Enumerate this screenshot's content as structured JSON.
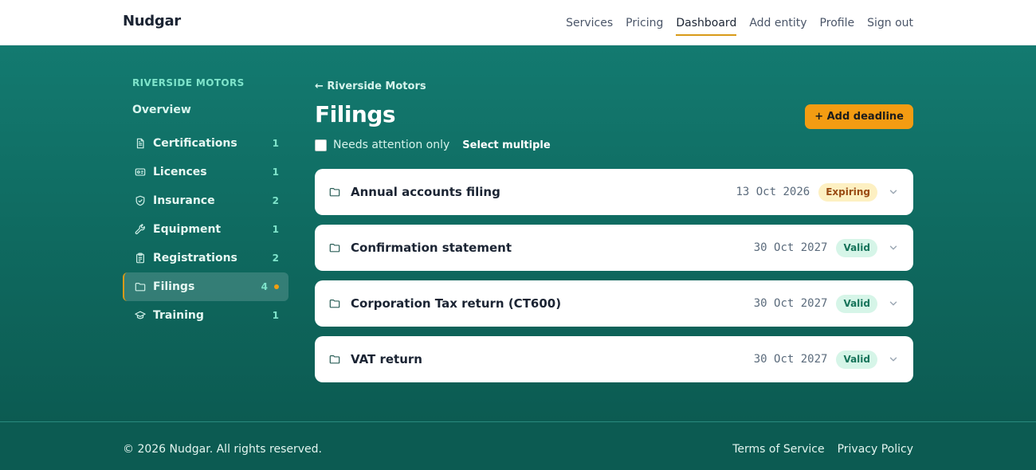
{
  "header": {
    "brand": "Nudgar",
    "nav": [
      {
        "label": "Services",
        "active": false
      },
      {
        "label": "Pricing",
        "active": false
      },
      {
        "label": "Dashboard",
        "active": true
      },
      {
        "label": "Add entity",
        "active": false
      },
      {
        "label": "Profile",
        "active": false
      },
      {
        "label": "Sign out",
        "active": false
      }
    ]
  },
  "sidebar": {
    "entity_name": "RIVERSIDE MOTORS",
    "overview_label": "Overview",
    "items": [
      {
        "label": "Certifications",
        "count": "1",
        "icon": "document-icon",
        "active": false
      },
      {
        "label": "Licences",
        "count": "1",
        "icon": "id-card-icon",
        "active": false
      },
      {
        "label": "Insurance",
        "count": "2",
        "icon": "shield-icon",
        "active": false
      },
      {
        "label": "Equipment",
        "count": "1",
        "icon": "wrench-icon",
        "active": false
      },
      {
        "label": "Registrations",
        "count": "2",
        "icon": "clipboard-icon",
        "active": false
      },
      {
        "label": "Filings",
        "count": "4",
        "icon": "folder-icon",
        "active": true,
        "attention": true
      },
      {
        "label": "Training",
        "count": "1",
        "icon": "graduation-cap-icon",
        "active": false
      }
    ]
  },
  "main": {
    "back_link": "← Riverside Motors",
    "title": "Filings",
    "add_button": "+ Add deadline",
    "filter_label": "Needs attention only",
    "select_multiple": "Select multiple",
    "filings": [
      {
        "name": "Annual accounts filing",
        "date": "13 Oct 2026",
        "status": "Expiring",
        "status_type": "expiring"
      },
      {
        "name": "Confirmation statement",
        "date": "30 Oct 2027",
        "status": "Valid",
        "status_type": "valid"
      },
      {
        "name": "Corporation Tax return (CT600)",
        "date": "30 Oct 2027",
        "status": "Valid",
        "status_type": "valid"
      },
      {
        "name": "VAT return",
        "date": "30 Oct 2027",
        "status": "Valid",
        "status_type": "valid"
      }
    ]
  },
  "footer": {
    "copyright": "© 2026 Nudgar. All rights reserved.",
    "links": [
      "Terms of Service",
      "Privacy Policy"
    ]
  },
  "colors": {
    "accent": "#f39c12",
    "teal": "#137a70",
    "active_underline": "#d89a18"
  }
}
